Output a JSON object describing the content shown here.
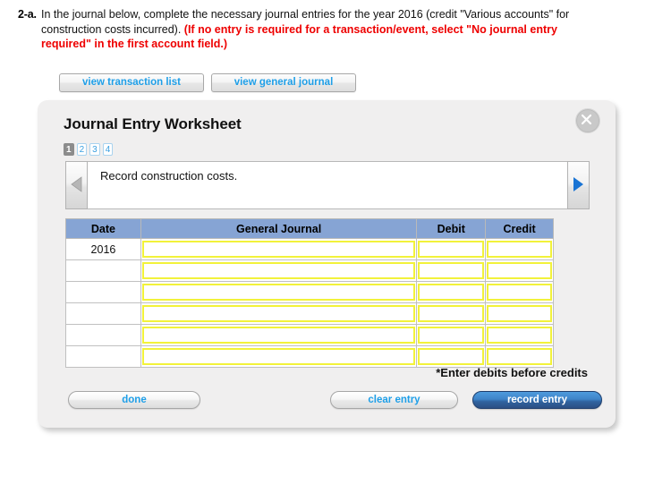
{
  "question": {
    "number": "2-a.",
    "text_plain_1": "In the journal below, complete the necessary journal entries for the year 2016 (credit \"Various accounts\" for construction costs incurred). ",
    "text_emphasis": "(If no entry is required for a transaction/event, select \"No journal entry required\" in the first account field.)",
    "emphasis_color": "#ee0000"
  },
  "view_buttons": {
    "transaction_list_label": "view transaction list",
    "general_journal_label": "view general journal",
    "link_color": "#1e9fe8"
  },
  "worksheet": {
    "title": "Journal Entry Worksheet",
    "close_icon": "close-x-icon",
    "pager": [
      {
        "label": "1",
        "active": true
      },
      {
        "label": "2",
        "active": false
      },
      {
        "label": "3",
        "active": false
      },
      {
        "label": "4",
        "active": false
      }
    ],
    "nav": {
      "prev_icon": "triangle-left-icon",
      "prev_enabled": false,
      "next_icon": "triangle-right-icon",
      "next_enabled": true,
      "prev_color": "#b0b0b0",
      "next_color": "#1a74d4"
    },
    "instruction": "Record construction costs.",
    "table": {
      "header_bg": "#86a4d4",
      "input_border": "#f2f23a",
      "columns": [
        "Date",
        "General Journal",
        "Debit",
        "Credit"
      ],
      "rows": [
        {
          "date": "2016",
          "general_journal": "",
          "debit": "",
          "credit": ""
        },
        {
          "date": "",
          "general_journal": "",
          "debit": "",
          "credit": ""
        },
        {
          "date": "",
          "general_journal": "",
          "debit": "",
          "credit": ""
        },
        {
          "date": "",
          "general_journal": "",
          "debit": "",
          "credit": ""
        },
        {
          "date": "",
          "general_journal": "",
          "debit": "",
          "credit": ""
        },
        {
          "date": "",
          "general_journal": "",
          "debit": "",
          "credit": ""
        }
      ]
    },
    "footnote": "*Enter debits before credits",
    "buttons": {
      "done_label": "done",
      "clear_entry_label": "clear entry",
      "record_entry_label": "record entry",
      "record_entry_bg": "#3f84c8"
    }
  }
}
